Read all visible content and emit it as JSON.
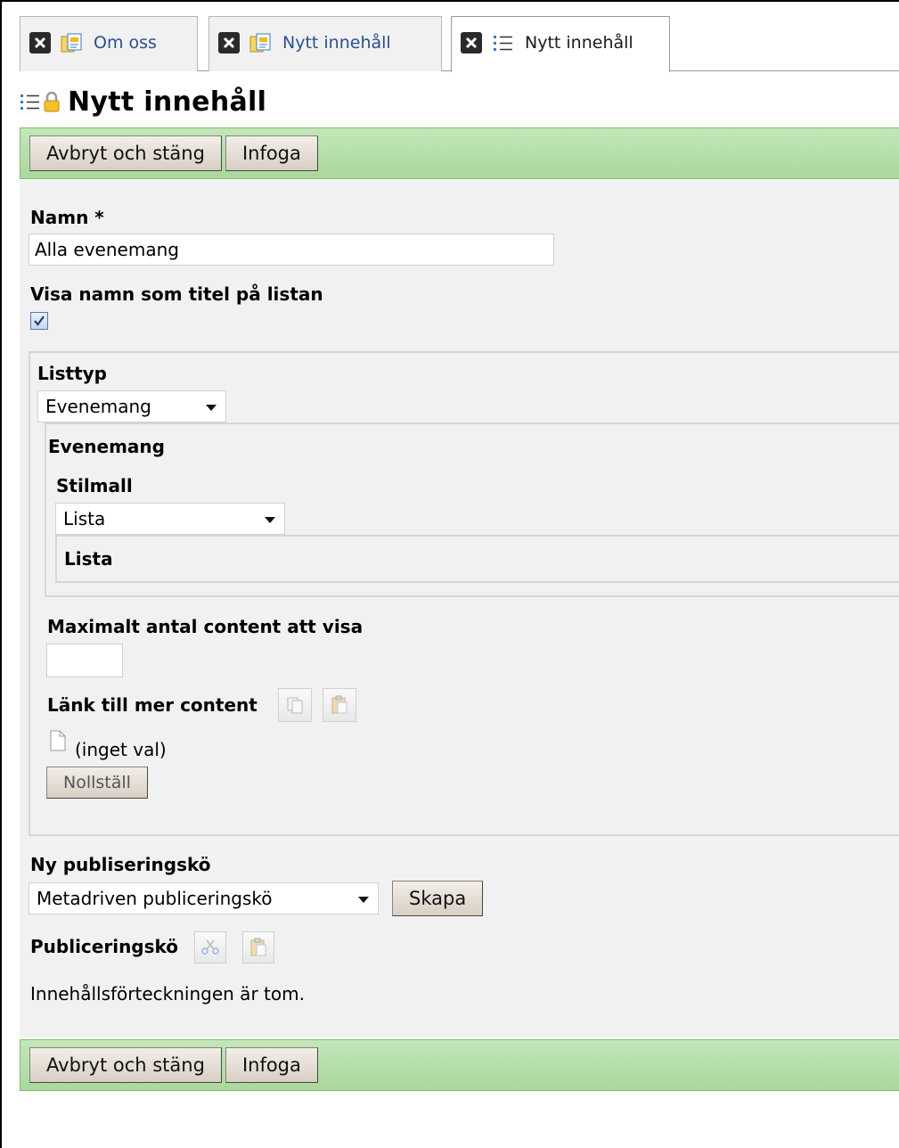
{
  "tabs": [
    {
      "label": "Om oss",
      "icon": "content-icon",
      "active": false
    },
    {
      "label": "Nytt innehåll",
      "icon": "content-icon",
      "active": false
    },
    {
      "label": "Nytt innehåll",
      "icon": "list-icon",
      "active": true
    }
  ],
  "page": {
    "title": "Nytt innehåll",
    "title_icons": [
      "list-icon",
      "lock-icon"
    ]
  },
  "toolbar": {
    "cancel_label": "Avbryt och stäng",
    "insert_label": "Infoga"
  },
  "form": {
    "name_label": "Namn *",
    "name_value": "Alla evenemang",
    "show_title_label": "Visa namn som titel på listan",
    "show_title_checked": true,
    "list_type_label": "Listtyp",
    "list_type_value": "Evenemang",
    "events_group_label": "Evenemang",
    "style_label": "Stilmall",
    "style_value": "Lista",
    "style_group_label": "Lista",
    "max_count_label": "Maximalt antal content att visa",
    "max_count_value": "",
    "link_label": "Länk till mer content",
    "link_value": "(inget val)",
    "reset_label": "Nollställ",
    "new_queue_label": "Ny publiseringskö",
    "new_queue_value": "Metadriven publiceringskö",
    "create_label": "Skapa",
    "queue_label": "Publiceringskö",
    "empty_text": "Innehållsförteckningen är tom."
  },
  "colors": {
    "toolbar_green": "#b5dfa9",
    "tab_link": "#2a4f8f",
    "panel_bg": "#f1f1f1"
  }
}
